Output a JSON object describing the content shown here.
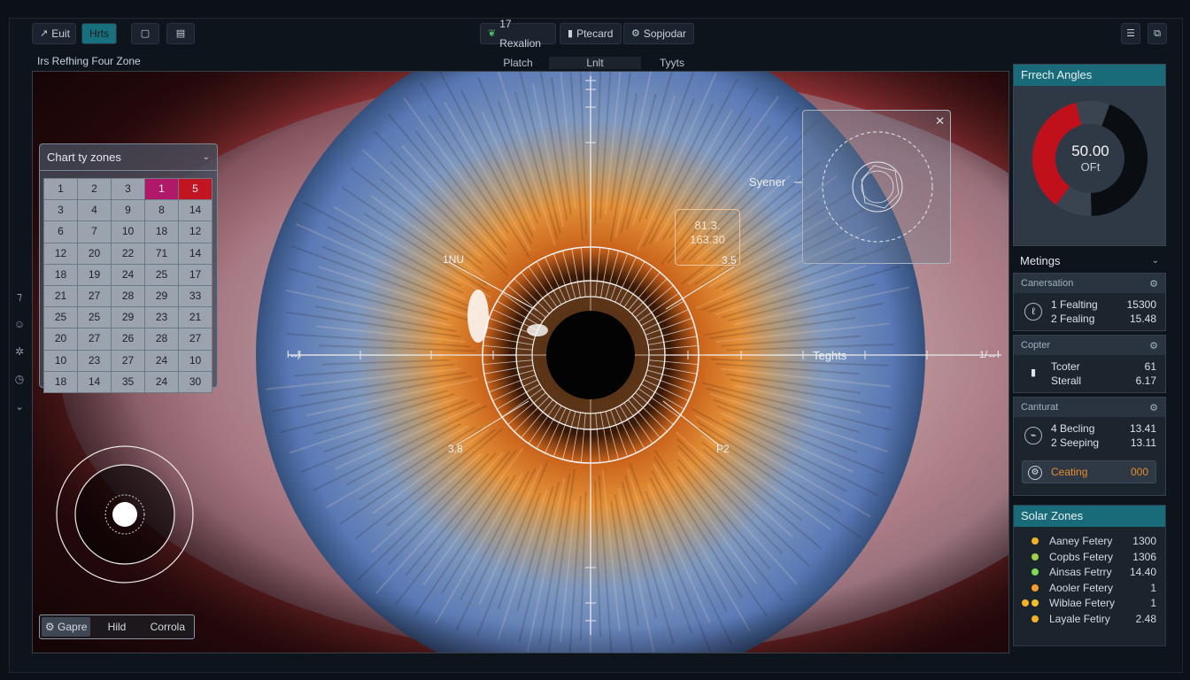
{
  "toolbar": {
    "left_buttons": [
      {
        "icon": "edit-icon",
        "glyph": "↗",
        "label": "Euit"
      },
      {
        "icon": "",
        "glyph": "",
        "label": "Hrts"
      },
      {
        "icon": "frame-icon",
        "glyph": "▢",
        "label": ""
      },
      {
        "icon": "layers-icon",
        "glyph": "▤",
        "label": ""
      }
    ],
    "center_buttons": [
      {
        "icon": "leaf-icon",
        "glyph": "❦",
        "label": "17 Rexalion"
      },
      {
        "icon": "card-icon",
        "glyph": "▮",
        "label": "Ptecard"
      },
      {
        "icon": "settings-icon",
        "glyph": "⚙",
        "label": "Sopjodar"
      }
    ],
    "right_buttons": [
      {
        "icon": "sliders-icon",
        "glyph": "☰"
      },
      {
        "icon": "expand-icon",
        "glyph": "⧉"
      }
    ]
  },
  "view": {
    "title": "Irs Refhing  Four Zone",
    "tabs": [
      "Platch",
      "Lnlt",
      "Tyyts"
    ],
    "selected_tab": 1
  },
  "zone_chart": {
    "title": "Chart ty zones",
    "rows": [
      [
        "1",
        "2",
        "3",
        "1",
        "5"
      ],
      [
        "3",
        "4",
        "9",
        "8",
        "14"
      ],
      [
        "6",
        "7",
        "10",
        "18",
        "12"
      ],
      [
        "12",
        "20",
        "22",
        "71",
        "14"
      ],
      [
        "18",
        "19",
        "24",
        "25",
        "17"
      ],
      [
        "21",
        "27",
        "28",
        "29",
        "33"
      ],
      [
        "25",
        "25",
        "29",
        "23",
        "21"
      ],
      [
        "20",
        "27",
        "26",
        "28",
        "27"
      ],
      [
        "10",
        "23",
        "27",
        "24",
        "10"
      ],
      [
        "18",
        "14",
        "35",
        "24",
        "30"
      ]
    ],
    "highlight_magenta": "#b0186a",
    "highlight_red": "#c11522"
  },
  "overlay": {
    "callout_line1": "81.3.",
    "callout_line2": "163.30",
    "label_syner": "Syener",
    "label_teghts": "Teghts",
    "label_nw": "1NU",
    "label_ne": "3.5",
    "label_sw": "3.8",
    "label_se": "P2",
    "tick_left": "l↔l",
    "tick_right": "1/↔l"
  },
  "bottom_segment": {
    "items": [
      {
        "icon": "gear-icon",
        "glyph": "⚙",
        "label": "Gapre"
      },
      {
        "icon": "",
        "glyph": "",
        "label": "Hild"
      },
      {
        "icon": "",
        "glyph": "",
        "label": "Corrola"
      }
    ],
    "selected": 0
  },
  "side_icons": [
    "⁊",
    "☺",
    "✲",
    "◷",
    "⌄"
  ],
  "fretch_angles": {
    "title": "Frrech Angles",
    "value": "50.00",
    "unit": "OFt",
    "red_fraction": 0.36,
    "dark_fraction": 0.44,
    "colors": {
      "red": "#c0101c",
      "dark": "#0a0d12",
      "ring_bg": "#3a4451"
    }
  },
  "metrics": {
    "title": "Metings",
    "sections": [
      {
        "name": "Canersation",
        "icon_glyph": "ℓ",
        "line1_label": "1 Fealting",
        "line1_value": "15300",
        "line2_label": "2 Fealing",
        "line2_value": "15.48"
      },
      {
        "name": "Copter",
        "icon_glyph": "▮",
        "line1_label": "Tcoter",
        "line1_value": "61",
        "line2_label": "Sterall",
        "line2_value": "6.17"
      },
      {
        "name": "Canturat",
        "icon_glyph": "⌁",
        "line1_label": "4 Becling",
        "line1_value": "13.41",
        "line2_label": "2 Seeping",
        "line2_value": "13.11"
      }
    ],
    "coating": {
      "icon_glyph": "⚙",
      "label": "Ceating",
      "value": "000"
    }
  },
  "solar_zones": {
    "title": "Solar Zones",
    "items": [
      {
        "name": "Aaney Fetery",
        "value": "1300",
        "color": "#f2b128"
      },
      {
        "name": "Copbs Fetery",
        "value": "1306",
        "color": "#9ed04a"
      },
      {
        "name": "Ainsas Fetrry",
        "value": "14.40",
        "color": "#7ed957"
      },
      {
        "name": "Aooler Fetery",
        "value": "1",
        "color": "#f59d2a"
      },
      {
        "name": "Wiblae Fetery",
        "value": "1",
        "color": "#f2c12a"
      },
      {
        "name": "Layale Fetiry",
        "value": "2.48",
        "color": "#f2b128"
      }
    ]
  }
}
